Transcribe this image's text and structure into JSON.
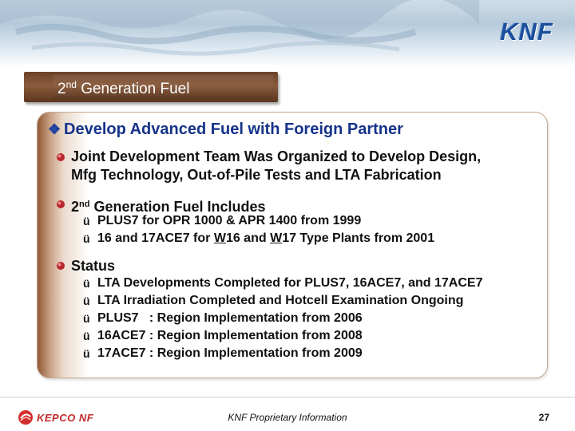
{
  "header": {
    "logo_text": "KNF"
  },
  "title": {
    "prefix": "2",
    "superscript": "nd",
    "suffix": " Generation Fuel"
  },
  "heading": {
    "icon": "diamond-bullet-icon",
    "text": "Develop Advanced Fuel with Foreign Partner"
  },
  "items": [
    {
      "line1": "Joint Development Team Was  Organized to Develop Design,",
      "line2": "Mfg Technology, Out-of-Pile Tests and LTA Fabrication"
    },
    {
      "prefix": "2",
      "superscript": "nd",
      "suffix": " Generation Fuel Includes",
      "subitems": [
        {
          "text": "PLUS7 for OPR 1000 & APR 1400 from 1999"
        },
        {
          "pre": "16 and 17ACE7 for ",
          "u1": "W",
          "mid": "16 and ",
          "u2": "W",
          "post": "17 Type Plants from 2001"
        }
      ]
    },
    {
      "text": "Status",
      "subitems": [
        "LTA Developments Completed for PLUS7, 16ACE7, and 17ACE7",
        "LTA Irradiation Completed and Hotcell Examination Ongoing",
        "PLUS7   : Region Implementation from 2006",
        "16ACE7 : Region Implementation from 2008",
        "17ACE7 : Region Implementation from 2009"
      ]
    }
  ],
  "check_glyph": "ü",
  "footer": {
    "company_logo_text": "KEPCO NF",
    "info": "KNF Proprietary Information",
    "page": "27"
  },
  "colors": {
    "heading": "#15338a",
    "title_box": "#7a4e31",
    "bullet": "#b8252b"
  }
}
